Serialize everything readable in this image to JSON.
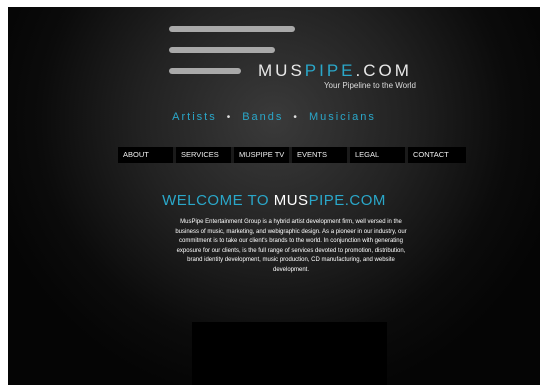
{
  "header": {
    "logo_primary": "MUS",
    "logo_accent": "PIPE",
    "logo_suffix": ".COM",
    "tagline": "Your Pipeline to the World"
  },
  "categories": [
    "Artists",
    "Bands",
    "Musicians"
  ],
  "category_separator": "•",
  "nav": {
    "about": "ABOUT",
    "services": "SERVICES",
    "muspipe_tv": "MUSPIPE TV",
    "events": "EVENTS",
    "legal": "LEGAL",
    "contact": "CONTACT"
  },
  "welcome": {
    "prefix": "WELCOME TO ",
    "mid": "MUS",
    "accent": "PIPE.COM"
  },
  "intro": "MusPipe Entertainment Group is a hybrid artist development firm, well versed in the business of music, marketing, and webigraphic design. As a pioneer in our industry, our commitment is to take our client's brands to the world. In conjunction with generating exposure for our clients, is the full range of services devoted to promotion, distribution, brand identity development, music production, CD manufacturing, and website development.",
  "colors": {
    "accent": "#2aa7c9",
    "background": "#1a1a1a",
    "logo_bars": "#a9a9a9"
  }
}
